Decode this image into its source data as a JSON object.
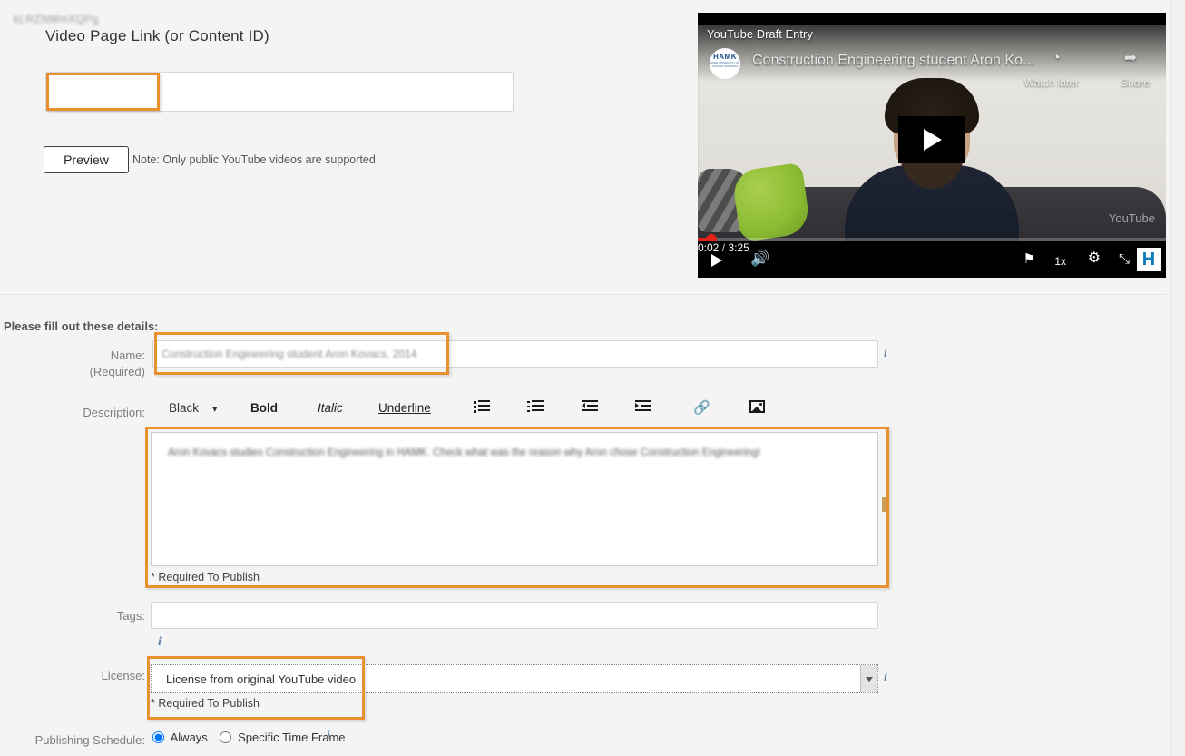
{
  "top": {
    "heading": "Video Page Link (or Content ID)",
    "link_value": "kLRZNMmXQPg",
    "link_placeholder": "",
    "preview_button": "Preview",
    "note": "Note: Only public YouTube videos are supported"
  },
  "player": {
    "overlay_label": "YouTube Draft Entry",
    "video_title": "Construction Engineering student Aron Ko...",
    "channel_avatar": "HAMK",
    "channel_avatar_sub": "HÄME UNIVERSITY OF APPLIED SCIENCES",
    "watch_later": "Watch later",
    "share": "Share",
    "youtube_wordmark": "YouTube",
    "current_time": "0:02",
    "time_separator": "/",
    "duration": "3:25",
    "speed": "1x",
    "brand_initial": "H",
    "icons": {
      "clock": "◔",
      "share_arrow": "➦",
      "volume": "🔊",
      "flag": "⚑",
      "gear": "⚙",
      "expand": "⤡"
    }
  },
  "details": {
    "heading": "Please fill out these details:",
    "name_label": "Name:",
    "name_required_label": "(Required)",
    "name_value": "Construction Engineering student Aron Kovacs, 2014",
    "description_label": "Description:",
    "description_value": "Aron Kovacs studies Construction Engineering in HAMK. Check what was the reason why Aron chose Construction Engineering!",
    "description_required": "* Required To Publish",
    "tags_label": "Tags:",
    "tags_value": "",
    "license_label": "License:",
    "license_value": "License from original YouTube video",
    "license_required": "* Required To Publish",
    "schedule_label": "Publishing Schedule:",
    "schedule_options": [
      "Always",
      "Specific Time Frame"
    ],
    "schedule_selected": "Always",
    "info_icon": "i"
  },
  "toolbar": {
    "color": "Black",
    "caret": "▾",
    "bold": "Bold",
    "italic": "Italic",
    "underline": "Underline",
    "link_icon": "🔗",
    "icons": [
      "unordered-list",
      "ordered-list",
      "outdent",
      "indent",
      "link",
      "image"
    ]
  },
  "colors": {
    "highlight_orange": "#e8912e",
    "page_background": "#f4f4f4",
    "accent_blue": "#0b7dbd",
    "progress_red": "#e62117",
    "info_blue": "#5b7ea5"
  }
}
